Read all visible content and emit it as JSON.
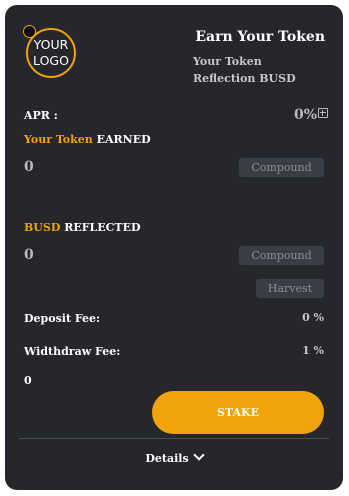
{
  "logo": {
    "line1": "YOUR",
    "line2": "LOGO"
  },
  "header": {
    "title": "Earn Your Token",
    "subtitle_line1": "Your Token",
    "subtitle_line2": "Reflection BUSD"
  },
  "apr": {
    "label": "APR :",
    "value": "0%"
  },
  "earned": {
    "token_label": "Your Token",
    "suffix_label": "EARNED",
    "value": "0",
    "compound_label": "Compound"
  },
  "reflected": {
    "token_label": "BUSD",
    "suffix_label": "REFLECTED",
    "value": "0",
    "compound_label": "Compound",
    "harvest_label": "Harvest"
  },
  "fees": {
    "deposit_label": "Deposit Fee:",
    "deposit_value": "0 %",
    "withdraw_label": "Widthdraw Fee:",
    "withdraw_value": "1 %"
  },
  "staked_value": "0",
  "stake_button_label": "STAKE",
  "details_label": "Details",
  "colors": {
    "accent": "#f0a30a",
    "card_bg": "#26272d"
  },
  "icons": {
    "apr_icon": "calculator-icon",
    "details_icon": "chevron-down-icon"
  }
}
